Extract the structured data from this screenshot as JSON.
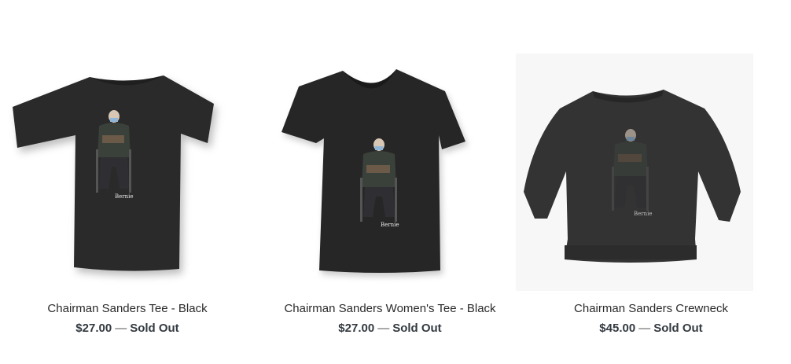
{
  "products": [
    {
      "title": "Chairman Sanders Tee - Black",
      "price": "$27.00",
      "separator": "—",
      "status": "Sold Out",
      "image_icon": "tshirt-black-icon",
      "logo_text": "Bernie"
    },
    {
      "title": "Chairman Sanders Women's Tee - Black",
      "price": "$27.00",
      "separator": "—",
      "status": "Sold Out",
      "image_icon": "womens-tshirt-black-icon",
      "logo_text": "Bernie"
    },
    {
      "title": "Chairman Sanders Crewneck",
      "price": "$45.00",
      "separator": "—",
      "status": "Sold Out",
      "image_icon": "crewneck-sweatshirt-icon",
      "logo_text": "Bernie"
    }
  ],
  "colors": {
    "garment": "#2b2b2b",
    "crewneck": "#333333",
    "text": "#2a2a2a"
  }
}
